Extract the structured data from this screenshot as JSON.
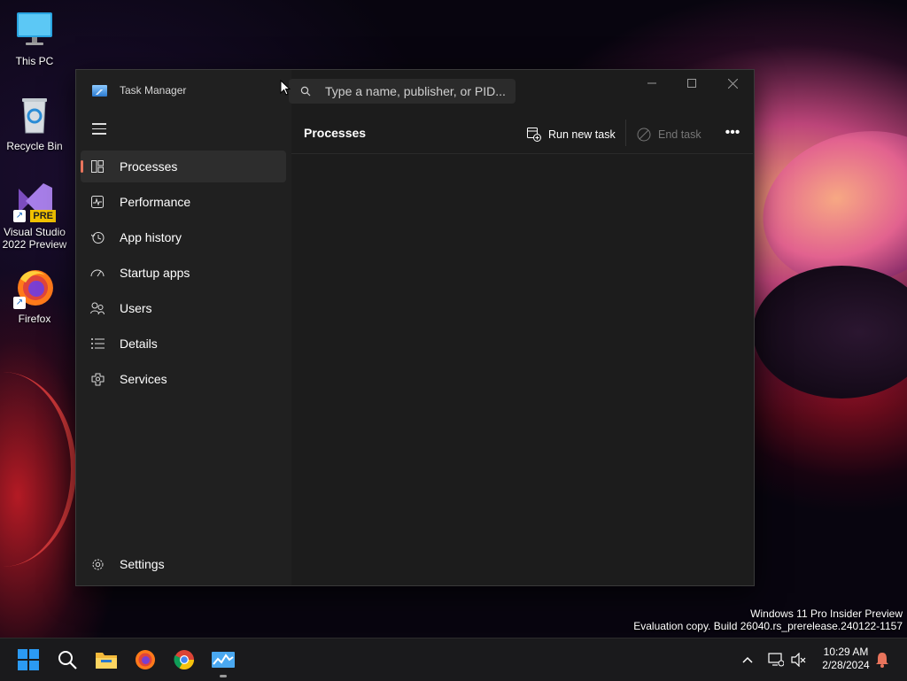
{
  "desktop": {
    "icons": [
      {
        "label": "This PC"
      },
      {
        "label": "Recycle Bin"
      },
      {
        "label": "Visual Studio 2022 Preview",
        "badge": "PRE"
      },
      {
        "label": "Firefox"
      }
    ],
    "watermark_line1": "Windows 11 Pro Insider Preview",
    "watermark_line2": "Evaluation copy. Build 26040.rs_prerelease.240122-1157"
  },
  "task_manager": {
    "title": "Task Manager",
    "search_placeholder": "Type a name, publisher, or PID...",
    "nav_items": [
      {
        "label": "Processes",
        "icon": "processes-icon",
        "active": true
      },
      {
        "label": "Performance",
        "icon": "performance-icon"
      },
      {
        "label": "App history",
        "icon": "history-icon"
      },
      {
        "label": "Startup apps",
        "icon": "startup-icon"
      },
      {
        "label": "Users",
        "icon": "users-icon"
      },
      {
        "label": "Details",
        "icon": "details-icon"
      },
      {
        "label": "Services",
        "icon": "services-icon"
      }
    ],
    "settings_label": "Settings",
    "page_title": "Processes",
    "run_new_task": "Run new task",
    "end_task": "End task",
    "more": "•••",
    "accent_color": "#e8745c"
  },
  "taskbar": {
    "time": "10:29 AM",
    "date": "2/28/2024",
    "pinned": [
      "start",
      "search",
      "file-explorer",
      "firefox",
      "chrome",
      "task-manager"
    ]
  }
}
